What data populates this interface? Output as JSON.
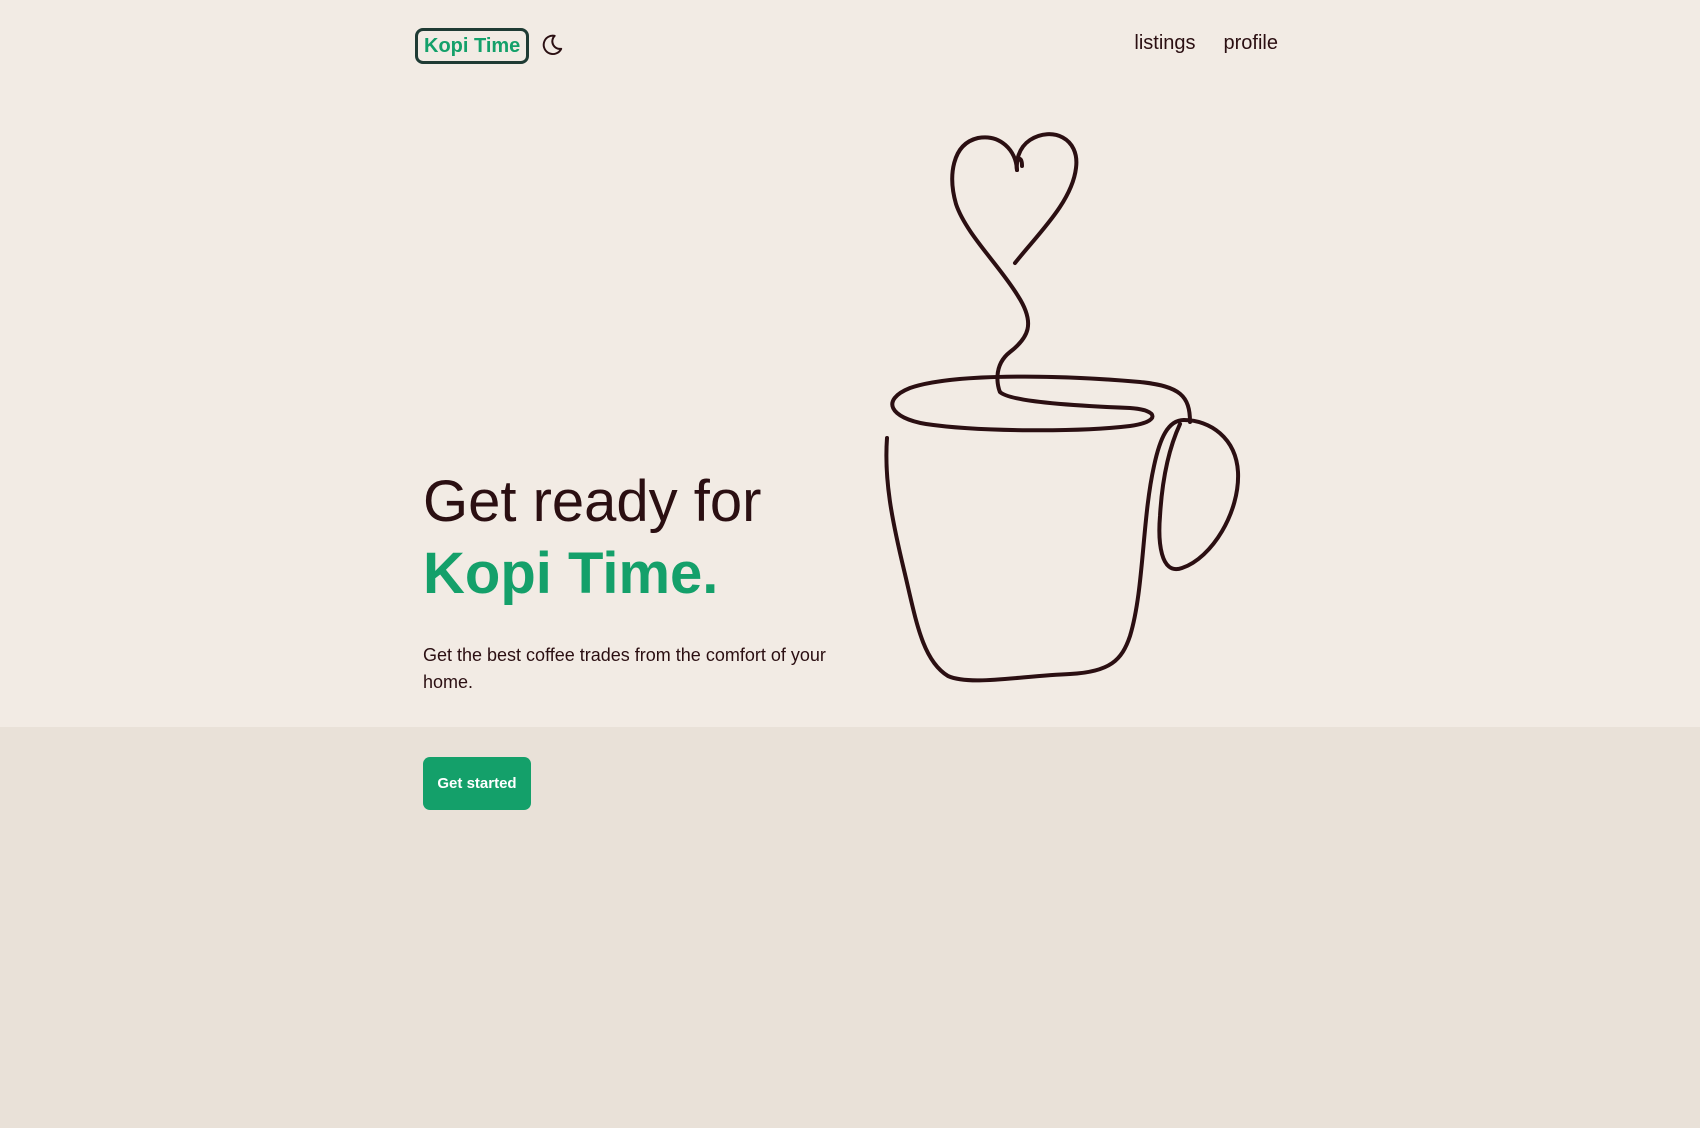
{
  "header": {
    "logo_text": "Kopi Time",
    "theme_toggle_icon": "moon-icon",
    "nav": [
      {
        "label": "listings"
      },
      {
        "label": "profile"
      }
    ]
  },
  "hero": {
    "title_line1": "Get ready for",
    "title_line2": "Kopi Time.",
    "subtitle": "Get the best coffee trades from the comfort of your home.",
    "cta_label": "Get started",
    "illustration_icon": "coffee-cup-heart-steam-illustration"
  },
  "colors": {
    "accent": "#14a06a",
    "text": "#2b0f12",
    "hero_background": "#f2ebe4",
    "page_background": "#e9e1d8"
  }
}
